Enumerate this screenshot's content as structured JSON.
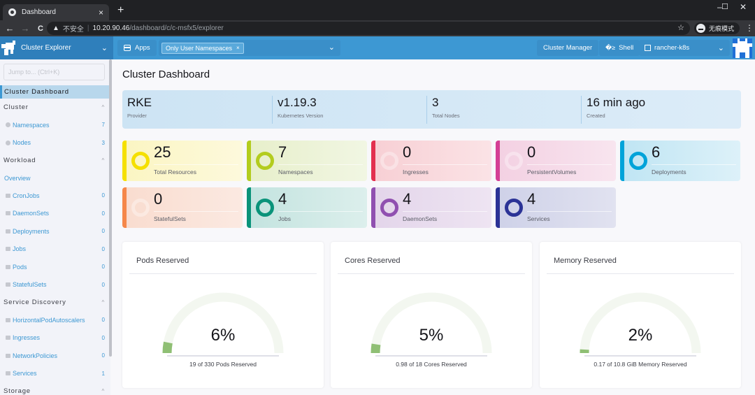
{
  "browser": {
    "tab_title": "Dashboard",
    "tab_close": "×",
    "new_tab": "+",
    "window_controls": {
      "minimize": "–",
      "maximize": "☐",
      "close": "✕"
    },
    "nav": {
      "back": "←",
      "forward": "→",
      "reload": "C"
    },
    "security_warning": "不安全",
    "url_host": "10.20.90.46",
    "url_path": "/dashboard/c/c-msfx5/explorer",
    "incognito_label": "无痕模式",
    "menu": "⋮",
    "star": "☆"
  },
  "header": {
    "product": "Cluster Explorer",
    "apps_label": "Apps",
    "namespace_filter_chip": "Only User Namespaces",
    "chip_remove": "×",
    "cluster_manager_label": "Cluster Manager",
    "shell_label": "Shell",
    "cluster_name": "rancher-k8s",
    "chevron": "⌄"
  },
  "sidebar": {
    "jump_placeholder": "Jump to... (Ctrl+K)",
    "active_item": "Cluster Dashboard",
    "groups": [
      {
        "label": "Cluster",
        "items": [
          {
            "label": "Namespaces",
            "count": "7",
            "icon": "globe-icon"
          },
          {
            "label": "Nodes",
            "count": "3",
            "icon": "globe-icon"
          }
        ]
      },
      {
        "label": "Workload",
        "overview": "Overview",
        "items": [
          {
            "label": "CronJobs",
            "count": "0",
            "icon": "folder-icon"
          },
          {
            "label": "DaemonSets",
            "count": "0",
            "icon": "folder-icon"
          },
          {
            "label": "Deployments",
            "count": "0",
            "icon": "folder-icon"
          },
          {
            "label": "Jobs",
            "count": "0",
            "icon": "folder-icon"
          },
          {
            "label": "Pods",
            "count": "0",
            "icon": "folder-icon"
          },
          {
            "label": "StatefulSets",
            "count": "0",
            "icon": "folder-icon"
          }
        ]
      },
      {
        "label": "Service Discovery",
        "items": [
          {
            "label": "HorizontalPodAutoscalers",
            "count": "0",
            "icon": "folder-icon"
          },
          {
            "label": "Ingresses",
            "count": "0",
            "icon": "folder-icon"
          },
          {
            "label": "NetworkPolicies",
            "count": "0",
            "icon": "folder-icon"
          },
          {
            "label": "Services",
            "count": "1",
            "icon": "folder-icon"
          }
        ]
      },
      {
        "label": "Storage",
        "items": []
      }
    ],
    "caret": "^"
  },
  "main": {
    "title": "Cluster Dashboard",
    "summary": [
      {
        "value": "RKE",
        "label": "Provider"
      },
      {
        "value": "v1.19.3",
        "label": "Kubernetes Version"
      },
      {
        "value": "3",
        "label": "Total Nodes"
      },
      {
        "value": "16 min ago",
        "label": "Created"
      }
    ],
    "tiles": [
      {
        "value": "25",
        "label": "Total Resources",
        "color": "#f5e000",
        "bg_from": "#fbf5c2",
        "bg_to": "#fdf9dc",
        "ring_active": true
      },
      {
        "value": "7",
        "label": "Namespaces",
        "color": "#b3cc1e",
        "bg_from": "#e7efca",
        "bg_to": "#f1f6e3",
        "ring_active": true
      },
      {
        "value": "0",
        "label": "Ingresses",
        "color": "#e3304f",
        "bg_from": "#f7cfd4",
        "bg_to": "#fbe3e6",
        "ring_active": false
      },
      {
        "value": "0",
        "label": "PersistentVolumes",
        "color": "#d43f95",
        "bg_from": "#f3d0e2",
        "bg_to": "#f8e5ef",
        "ring_active": false
      },
      {
        "value": "6",
        "label": "Deployments",
        "color": "#00a3d9",
        "bg_from": "#bfe5f3",
        "bg_to": "#ddf1f9",
        "ring_active": true
      },
      {
        "value": "0",
        "label": "StatefulSets",
        "color": "#f5874a",
        "bg_from": "#f9dccf",
        "bg_to": "#fbe9e1",
        "ring_active": false
      },
      {
        "value": "4",
        "label": "Jobs",
        "color": "#0a937a",
        "bg_from": "#c3e3df",
        "bg_to": "#dcefec",
        "ring_active": true
      },
      {
        "value": "4",
        "label": "DaemonSets",
        "color": "#9050b0",
        "bg_from": "#e3d5ea",
        "bg_to": "#eee4f2",
        "ring_active": true
      },
      {
        "value": "4",
        "label": "Services",
        "color": "#2b3396",
        "bg_from": "#ced1e8",
        "bg_to": "#e1e2f0",
        "ring_active": true
      }
    ],
    "gauges": [
      {
        "title": "Pods Reserved",
        "percent_label": "6%",
        "fraction": 0.06,
        "caption": "19 of 330 Pods Reserved"
      },
      {
        "title": "Cores Reserved",
        "percent_label": "5%",
        "fraction": 0.05,
        "caption": "0.98 of 18 Cores Reserved"
      },
      {
        "title": "Memory Reserved",
        "percent_label": "2%",
        "fraction": 0.02,
        "caption": "0.17 of 10.8 GiB Memory Reserved"
      }
    ],
    "gauge_colors": {
      "fill": "#8fbf74",
      "track": "#f3f7f0"
    }
  }
}
